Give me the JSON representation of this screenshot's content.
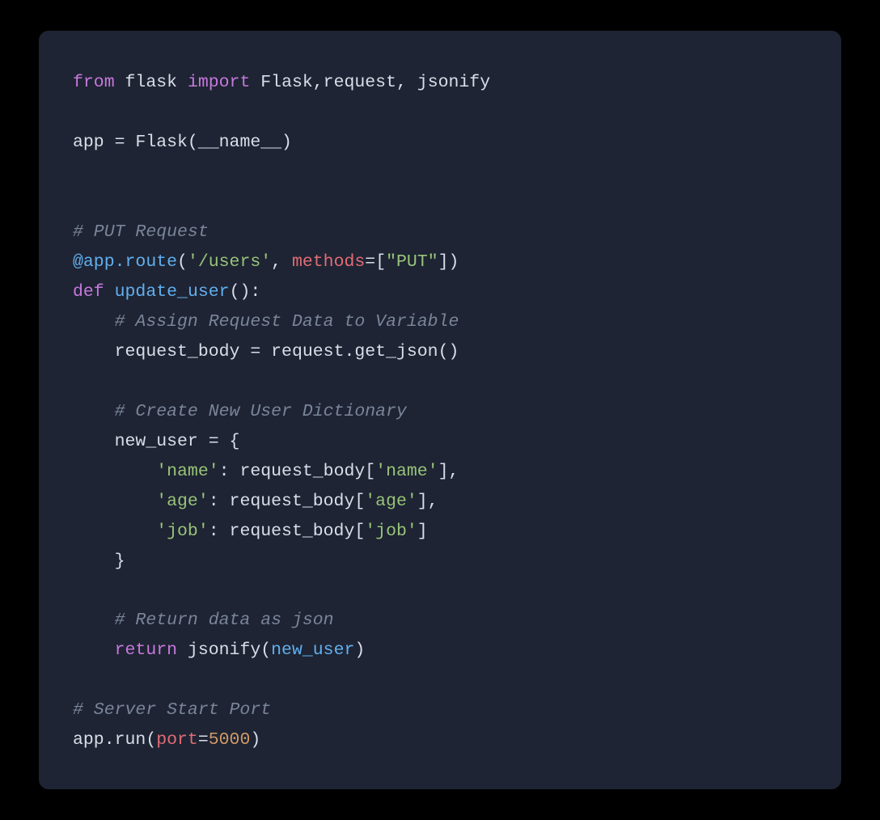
{
  "code": {
    "language": "python",
    "lines": [
      [
        {
          "cls": "kw",
          "text": "from"
        },
        {
          "cls": "",
          "text": " flask "
        },
        {
          "cls": "kw",
          "text": "import"
        },
        {
          "cls": "",
          "text": " Flask,request, jsonify"
        }
      ],
      [],
      [
        {
          "cls": "",
          "text": "app "
        },
        {
          "cls": "op",
          "text": "="
        },
        {
          "cls": "",
          "text": " Flask(__name__)"
        }
      ],
      [],
      [],
      [
        {
          "cls": "com",
          "text": "# PUT Request"
        }
      ],
      [
        {
          "cls": "dec",
          "text": "@app.route"
        },
        {
          "cls": "",
          "text": "("
        },
        {
          "cls": "str",
          "text": "'/users'"
        },
        {
          "cls": "",
          "text": ", "
        },
        {
          "cls": "att",
          "text": "methods"
        },
        {
          "cls": "op",
          "text": "="
        },
        {
          "cls": "",
          "text": "["
        },
        {
          "cls": "str",
          "text": "\"PUT\""
        },
        {
          "cls": "",
          "text": "])"
        }
      ],
      [
        {
          "cls": "kw",
          "text": "def"
        },
        {
          "cls": "",
          "text": " "
        },
        {
          "cls": "fn",
          "text": "update_user"
        },
        {
          "cls": "",
          "text": "():"
        }
      ],
      [
        {
          "cls": "",
          "text": "    "
        },
        {
          "cls": "com",
          "text": "# Assign Request Data to Variable"
        }
      ],
      [
        {
          "cls": "",
          "text": "    request_body "
        },
        {
          "cls": "op",
          "text": "="
        },
        {
          "cls": "",
          "text": " request.get_json()"
        }
      ],
      [],
      [
        {
          "cls": "",
          "text": "    "
        },
        {
          "cls": "com",
          "text": "# Create New User Dictionary"
        }
      ],
      [
        {
          "cls": "",
          "text": "    new_user "
        },
        {
          "cls": "op",
          "text": "="
        },
        {
          "cls": "",
          "text": " {"
        }
      ],
      [
        {
          "cls": "",
          "text": "        "
        },
        {
          "cls": "str",
          "text": "'name'"
        },
        {
          "cls": "",
          "text": ": request_body["
        },
        {
          "cls": "str",
          "text": "'name'"
        },
        {
          "cls": "",
          "text": "],"
        }
      ],
      [
        {
          "cls": "",
          "text": "        "
        },
        {
          "cls": "str",
          "text": "'age'"
        },
        {
          "cls": "",
          "text": ": request_body["
        },
        {
          "cls": "str",
          "text": "'age'"
        },
        {
          "cls": "",
          "text": "],"
        }
      ],
      [
        {
          "cls": "",
          "text": "        "
        },
        {
          "cls": "str",
          "text": "'job'"
        },
        {
          "cls": "",
          "text": ": request_body["
        },
        {
          "cls": "str",
          "text": "'job'"
        },
        {
          "cls": "",
          "text": "]"
        }
      ],
      [
        {
          "cls": "",
          "text": "    }"
        }
      ],
      [],
      [
        {
          "cls": "",
          "text": "    "
        },
        {
          "cls": "com",
          "text": "# Return data as json"
        }
      ],
      [
        {
          "cls": "",
          "text": "    "
        },
        {
          "cls": "kw",
          "text": "return"
        },
        {
          "cls": "",
          "text": " jsonify("
        },
        {
          "cls": "fn",
          "text": "new_user"
        },
        {
          "cls": "",
          "text": ")"
        }
      ],
      [],
      [
        {
          "cls": "com",
          "text": "# Server Start Port"
        }
      ],
      [
        {
          "cls": "",
          "text": "app.run("
        },
        {
          "cls": "att",
          "text": "port"
        },
        {
          "cls": "op",
          "text": "="
        },
        {
          "cls": "num",
          "text": "5000"
        },
        {
          "cls": "",
          "text": ")"
        }
      ]
    ]
  }
}
